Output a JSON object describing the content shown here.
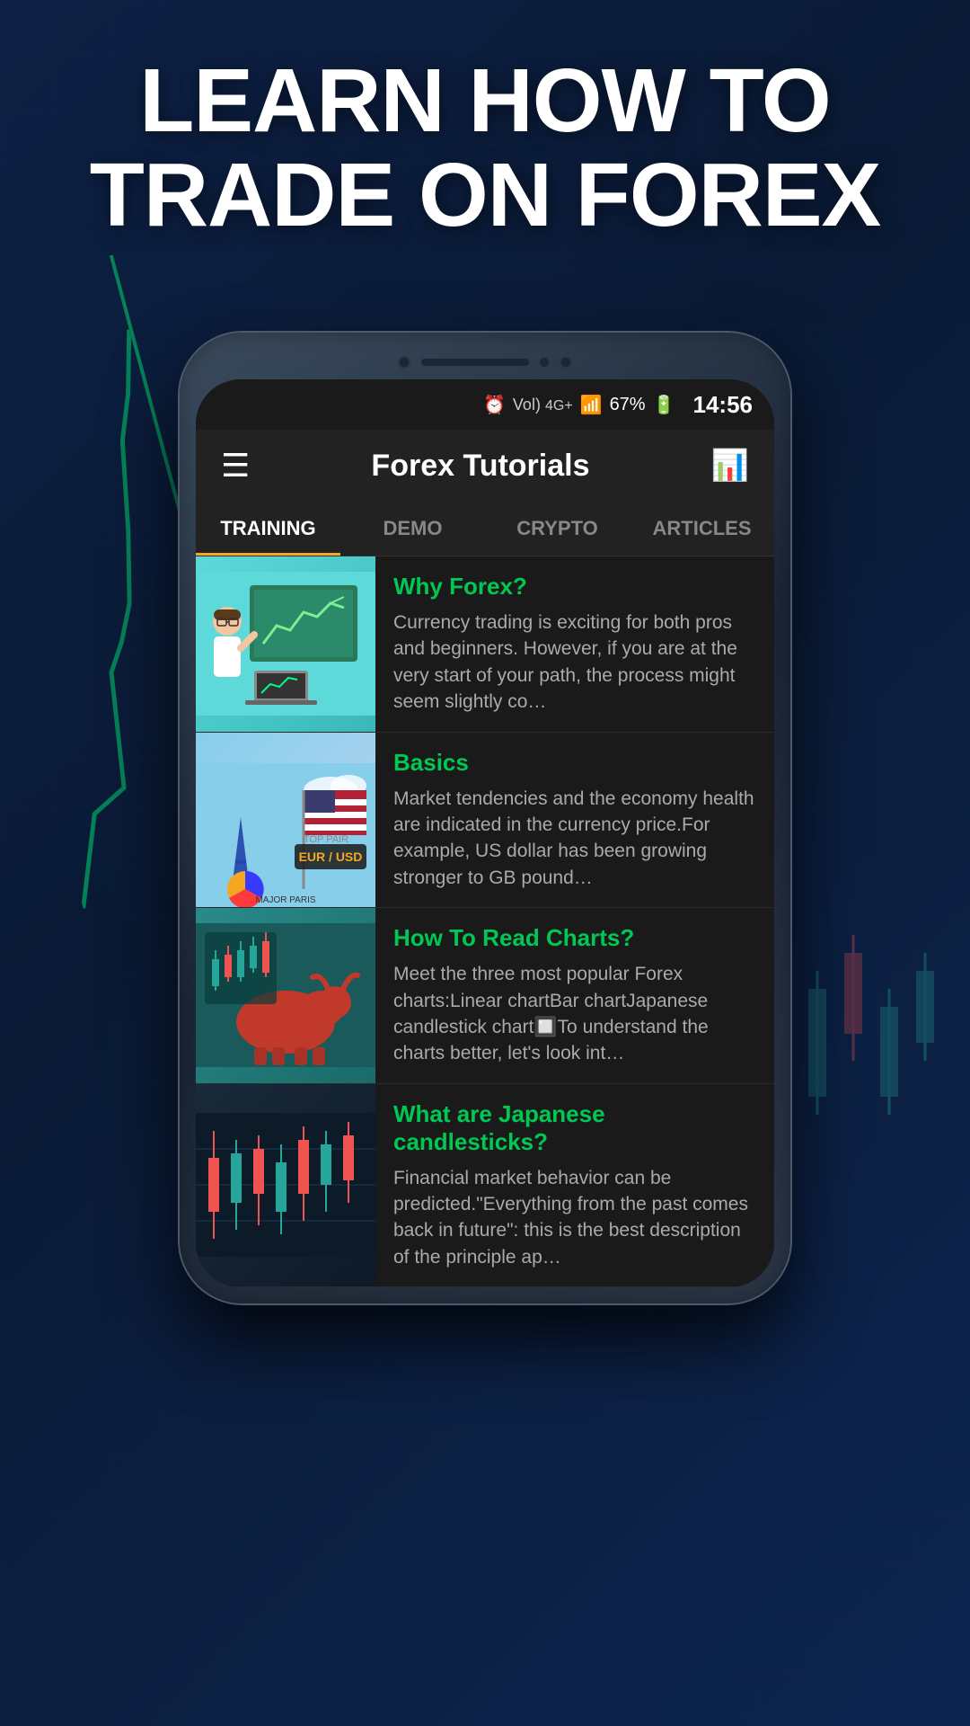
{
  "hero": {
    "title_line1": "LEARN HOW TO",
    "title_line2": "TRADE ON FOREX"
  },
  "status_bar": {
    "alarm": "⏰",
    "signal": "Vol) 4G+",
    "battery_pct": "67%",
    "battery_icon": "🔋",
    "time": "14:56"
  },
  "header": {
    "title": "Forex Tutorials",
    "menu_icon": "☰",
    "chart_icon": "📈"
  },
  "tabs": [
    {
      "label": "TRAINING",
      "active": true
    },
    {
      "label": "DEMO",
      "active": false
    },
    {
      "label": "CRYPTO",
      "active": false
    },
    {
      "label": "ARTICLES",
      "active": false
    }
  ],
  "articles": [
    {
      "title": "Why Forex?",
      "excerpt": "Currency trading is exciting for both pros and beginners. However, if you are at the very start of your path, the process might seem slightly co…",
      "thumb_type": "why-forex"
    },
    {
      "title": "Basics",
      "excerpt": "Market tendencies and the economy health are indicated in the currency price.For example, US dollar has been growing stronger to GB pound…",
      "thumb_type": "basics"
    },
    {
      "title": "How To Read Charts?",
      "excerpt": "Meet the three most popular Forex charts:Linear chartBar chartJapanese candlestick chart🔲To understand the charts better, let's look int…",
      "thumb_type": "charts"
    },
    {
      "title": "What are Japanese candlesticks?",
      "excerpt": "Financial market behavior can be predicted.\"Everything from the past comes back in future\": this is the best description of the principle ap…",
      "thumb_type": "candlesticks"
    }
  ],
  "colors": {
    "accent_orange": "#f5a623",
    "accent_green": "#00c853",
    "bg_dark": "#1a1a1a",
    "bg_header": "#222222",
    "text_primary": "#ffffff",
    "text_secondary": "#aaaaaa"
  }
}
